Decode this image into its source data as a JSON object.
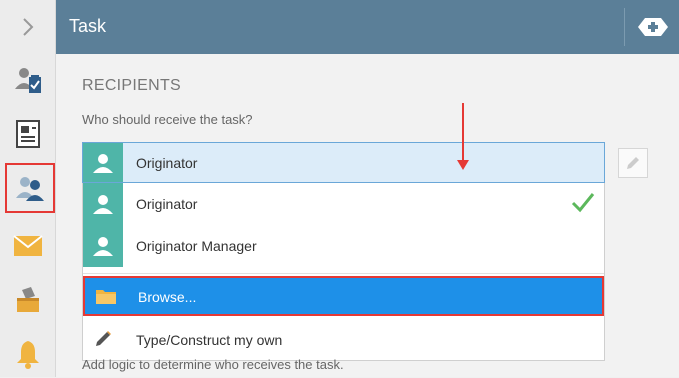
{
  "header": {
    "title": "Task"
  },
  "recipients": {
    "section_title": "RECIPIENTS",
    "question": "Who should receive the task?",
    "selected_value": "Originator",
    "hint": "Add logic to determine who receives the task."
  },
  "dropdown": {
    "items": [
      {
        "label": "Originator",
        "icon": "user-avatar-icon",
        "checked": true
      },
      {
        "label": "Originator Manager",
        "icon": "user-avatar-icon",
        "checked": false
      },
      {
        "label": "Browse...",
        "icon": "folder-icon",
        "highlighted": true
      },
      {
        "label": "Type/Construct my own",
        "icon": "pencil-icon"
      }
    ]
  },
  "rail": {
    "items": [
      "expand-chevron-icon",
      "task-assignment-icon",
      "form-document-icon",
      "recipients-icon",
      "email-icon",
      "ballot-box-icon",
      "bell-icon"
    ]
  },
  "colors": {
    "header": "#5b7f98",
    "accent": "#1e90e8",
    "avatar": "#4fb5a8",
    "highlight_border": "#e53935"
  }
}
